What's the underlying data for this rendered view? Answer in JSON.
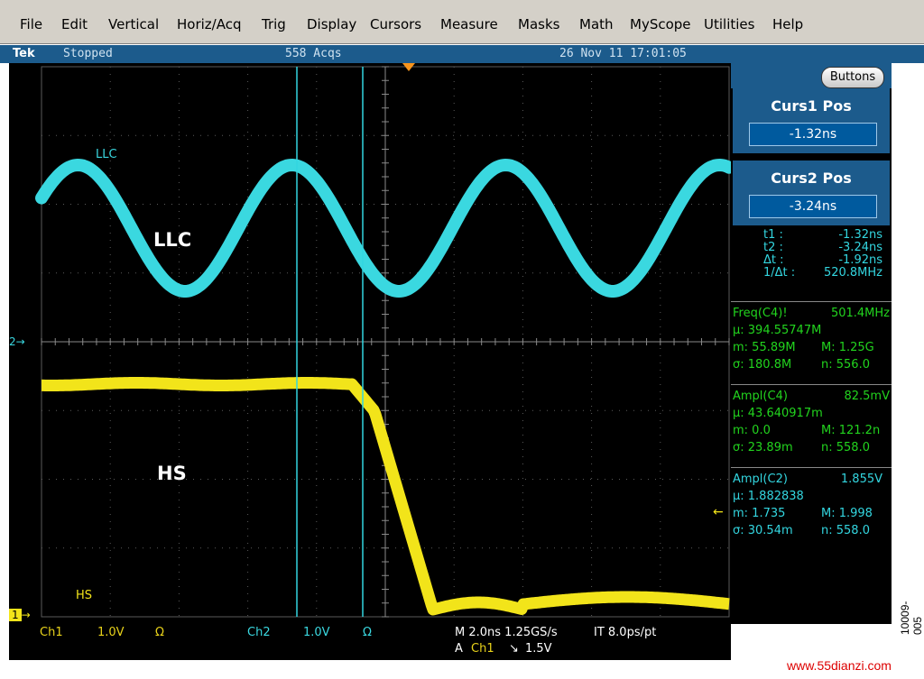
{
  "menu": [
    "File",
    "Edit",
    "Vertical",
    "Horiz/Acq",
    "Trig",
    "Display",
    "Cursors",
    "Measure",
    "Masks",
    "Math",
    "MyScope",
    "Utilities",
    "Help"
  ],
  "status": {
    "brand": "Tek",
    "state": "Stopped",
    "acqs": "558 Acqs",
    "datetime": "26 Nov 11 17:01:05"
  },
  "buttons_label": "Buttons",
  "curs1": {
    "title": "Curs1 Pos",
    "value": "-1.32ns"
  },
  "curs2": {
    "title": "Curs2 Pos",
    "value": "-3.24ns"
  },
  "cursor_readout": [
    {
      "k": "t1 :",
      "v": "-1.32ns"
    },
    {
      "k": "t2 :",
      "v": "-3.24ns"
    },
    {
      "k": "Δt :",
      "v": "-1.92ns"
    },
    {
      "k": "1/Δt :",
      "v": "520.8MHz"
    }
  ],
  "measurements": [
    {
      "lines": [
        [
          "Freq(C4)!",
          "501.4MHz"
        ],
        [
          "µ: 394.55747M",
          ""
        ],
        [
          "m: 55.89M",
          "M: 1.25G"
        ],
        [
          "σ: 180.8M",
          "n: 556.0"
        ]
      ]
    },
    {
      "lines": [
        [
          "Ampl(C4)",
          "82.5mV"
        ],
        [
          "µ: 43.640917m",
          ""
        ],
        [
          "m: 0.0",
          "M: 121.2n"
        ],
        [
          "σ: 23.89m",
          "n: 558.0"
        ]
      ]
    },
    {
      "lines": [
        [
          "Ampl(C2)",
          "1.855V"
        ],
        [
          "µ: 1.882838",
          ""
        ],
        [
          "m: 1.735",
          "M: 1.998"
        ],
        [
          "σ: 30.54m",
          "n: 558.0"
        ]
      ]
    }
  ],
  "waveforms": {
    "llc_label_small": "LLC",
    "llc_label_big": "LLC",
    "hs_label_big": "HS",
    "hs_label_small": "HS",
    "llc_color": "#3ad8e0",
    "hs_color": "#f2e41a",
    "grid_color": "#5a5a5a",
    "marker_2": "2",
    "marker_1": "1"
  },
  "bottom": {
    "ch1": "Ch1",
    "ch1_scale": "1.0V",
    "ch1_omega": "Ω",
    "ch2": "Ch2",
    "ch2_scale": "1.0V",
    "ch2_omega": "Ω",
    "horiz": "M 2.0ns  1.25GS/s",
    "it": "IT 8.0ps/pt",
    "trig_a": "A",
    "trig_ch": "Ch1",
    "trig_slope": "↘",
    "trig_level": "1.5V"
  },
  "figure_code": "10009-005",
  "watermark": "www.55dianzi.com"
}
